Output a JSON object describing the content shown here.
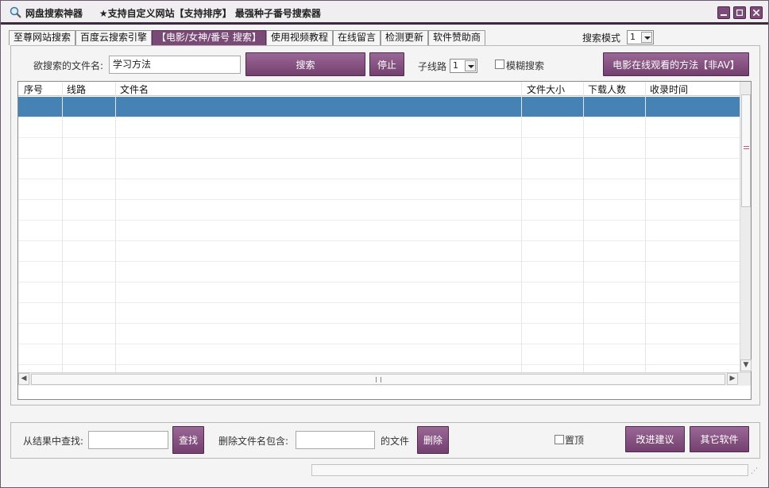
{
  "window": {
    "app_name": "网盘搜索神器",
    "subtitle": "★支持自定义网站【支持排序】 最强种子番号搜索器"
  },
  "tabs": [
    {
      "label": "至尊网站搜索",
      "active": false
    },
    {
      "label": "百度云搜索引擎",
      "active": false
    },
    {
      "label": "【电影/女神/番号  搜索】",
      "active": true
    },
    {
      "label": "使用视频教程",
      "active": false
    },
    {
      "label": "在线留言",
      "active": false
    },
    {
      "label": "检测更新",
      "active": false
    },
    {
      "label": "软件赞助商",
      "active": false
    }
  ],
  "search_mode": {
    "label": "搜索模式",
    "value": "1"
  },
  "search_bar": {
    "label": "欲搜索的文件名:",
    "value": "学习方法",
    "search_button": "搜索",
    "stop_button": "停止",
    "subline_label": "子线路",
    "subline_value": "1",
    "fuzzy_label": "模糊搜索",
    "online_button": "电影在线观看的方法【非AV】"
  },
  "table": {
    "columns": [
      "序号",
      "线路",
      "文件名",
      "文件大小",
      "下载人数",
      "收录时间"
    ],
    "rows": []
  },
  "bottom": {
    "find_label": "从结果中查找:",
    "find_value": "",
    "find_button": "查找",
    "delete_label": "删除文件名包含:",
    "delete_value": "",
    "delete_suffix": "的文件",
    "delete_button": "删除",
    "pin_label": "置顶",
    "suggest_button": "改进建议",
    "other_button": "其它软件"
  },
  "colors": {
    "accent": "#7a4a77",
    "selection": "#4682b4",
    "titlebar_border": "#3c2a3f"
  }
}
